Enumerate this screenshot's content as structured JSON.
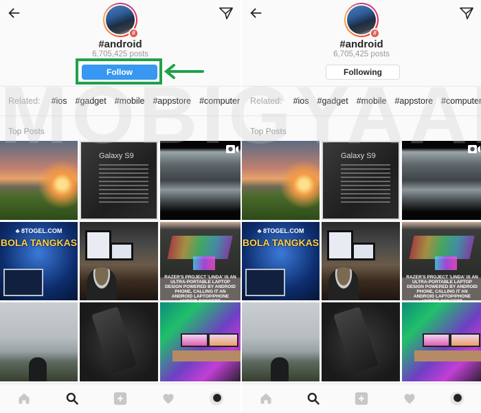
{
  "watermark": "MOBIGYAAN",
  "panels": [
    {
      "state": "not-following",
      "header": {
        "back": "back-arrow",
        "send": "direct-message"
      },
      "hashtag": "#android",
      "posts_count": "6,705,425 posts",
      "button_label": "Follow",
      "annotation": {
        "highlight_color": "#1fa14a",
        "arrow": "left-pointing green arrow"
      },
      "related_label": "Related:",
      "related_tags": [
        "#ios",
        "#gadget",
        "#mobile",
        "#appstore",
        "#computer"
      ],
      "section_title": "Top Posts"
    },
    {
      "state": "following",
      "header": {
        "back": "back-arrow",
        "send": "direct-message"
      },
      "hashtag": "#android",
      "posts_count": "6,705,425 posts",
      "button_label": "Following",
      "related_label": "Related:",
      "related_tags": [
        "#ios",
        "#gadget",
        "#mobile",
        "#appstore",
        "#computer"
      ],
      "section_title": "Top Posts"
    }
  ],
  "posts": [
    {
      "kind": "sunset-landscape"
    },
    {
      "kind": "galaxy-s9-box",
      "title": "Galaxy S9"
    },
    {
      "kind": "rocky-shore-video",
      "video": true
    },
    {
      "kind": "bola-tangkas-ad",
      "line1": "♣ 8TOGEL.COM",
      "line2": "BOLA TANGKAS"
    },
    {
      "kind": "desk-coffee"
    },
    {
      "kind": "razer-laptop",
      "caption": "Razer's Project 'Linda' is an ultra-portable laptop design powered by Android phone, calling it an Android laptop/phone hybrid concept"
    },
    {
      "kind": "foggy-hills-person"
    },
    {
      "kind": "black-phone"
    },
    {
      "kind": "gaming-setup"
    }
  ],
  "bottom_nav": [
    "home",
    "search",
    "new-post",
    "activity",
    "profile"
  ],
  "colors": {
    "follow_blue": "#3897f0",
    "annotation_green": "#1fa14a",
    "badge_red": "#e2574a"
  }
}
